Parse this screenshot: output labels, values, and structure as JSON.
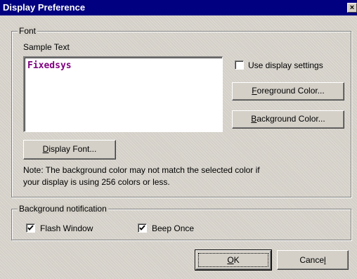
{
  "window": {
    "title": "Display Preference",
    "close_glyph": "×"
  },
  "font_group": {
    "legend": "Font",
    "sample_label": "Sample Text",
    "sample_value": "Fixedsys",
    "sample_color": "#800080",
    "use_display_settings": {
      "label": "Use display settings",
      "checked": false
    },
    "foreground_button": {
      "mnemonic": "F",
      "rest": "oreground Color..."
    },
    "background_button": {
      "mnemonic": "B",
      "rest": "ackground Color..."
    },
    "display_font_button": {
      "mnemonic": "D",
      "rest": "isplay Font..."
    },
    "note_line1": "Note:  The background color may not match the selected color if",
    "note_line2": "your display is using 256 colors or less."
  },
  "notification_group": {
    "legend": "Background notification",
    "flash_window": {
      "label": "Flash Window",
      "checked": true
    },
    "beep_once": {
      "label": "Beep Once",
      "checked": true
    }
  },
  "footer": {
    "ok_button": {
      "mnemonic": "O",
      "rest": "K"
    },
    "cancel_button": {
      "prefix": "Cance",
      "mnemonic": "l"
    }
  },
  "colors": {
    "titlebar": "#000080",
    "face": "#d4d0c8",
    "sample_text": "#800080"
  }
}
